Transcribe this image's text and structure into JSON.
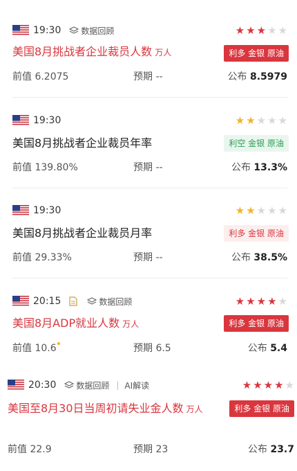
{
  "events": [
    {
      "time": "19:30",
      "replay": "数据回顾",
      "title": "美国8月挑战者企业裁员人数",
      "unit": "万人",
      "badge": "利多 金银 原油",
      "prev_label": "前值",
      "prev": "6.2075",
      "exp_label": "预期",
      "exp": "--",
      "pub_label": "公布",
      "pub": "8.5979",
      "stars": 3
    },
    {
      "time": "19:30",
      "title": "美国8月挑战者企业裁员年率",
      "badge": "利空 金银 原油",
      "prev_label": "前值",
      "prev": "139.80%",
      "exp_label": "预期",
      "exp": "--",
      "pub_label": "公布",
      "pub": "13.3%",
      "stars": 2
    },
    {
      "time": "19:30",
      "title": "美国8月挑战者企业裁员月率",
      "badge": "利多 金银 原油",
      "prev_label": "前值",
      "prev": "29.33%",
      "exp_label": "预期",
      "exp": "--",
      "pub_label": "公布",
      "pub": "38.5%",
      "stars": 2
    },
    {
      "time": "20:15",
      "replay": "数据回顾",
      "title": "美国8月ADP就业人数",
      "unit": "万人",
      "badge": "利多 金银 原油",
      "prev_label": "前值",
      "prev": "10.6",
      "exp_label": "预期",
      "exp": "6.5",
      "pub_label": "公布",
      "pub": "5.4",
      "stars": 4
    },
    {
      "time": "20:30",
      "replay": "数据回顾",
      "ai": "AI解读",
      "title": "美国至8月30日当周初请失业金人数",
      "unit": "万人",
      "badge": "利多 金银 原油",
      "prev_label": "前值",
      "prev": "22.9",
      "exp_label": "预期",
      "exp": "23",
      "pub_label": "公布",
      "pub": "23.7",
      "stars": 4
    }
  ],
  "colors": {
    "red": "#d9363e",
    "gold": "#f0b429",
    "green": "#2e9d55",
    "grey_star": "#d8d8d8"
  },
  "icons": {
    "flag": "us-flag-icon",
    "replay": "layers-icon",
    "doc": "document-icon",
    "star": "star-icon"
  }
}
